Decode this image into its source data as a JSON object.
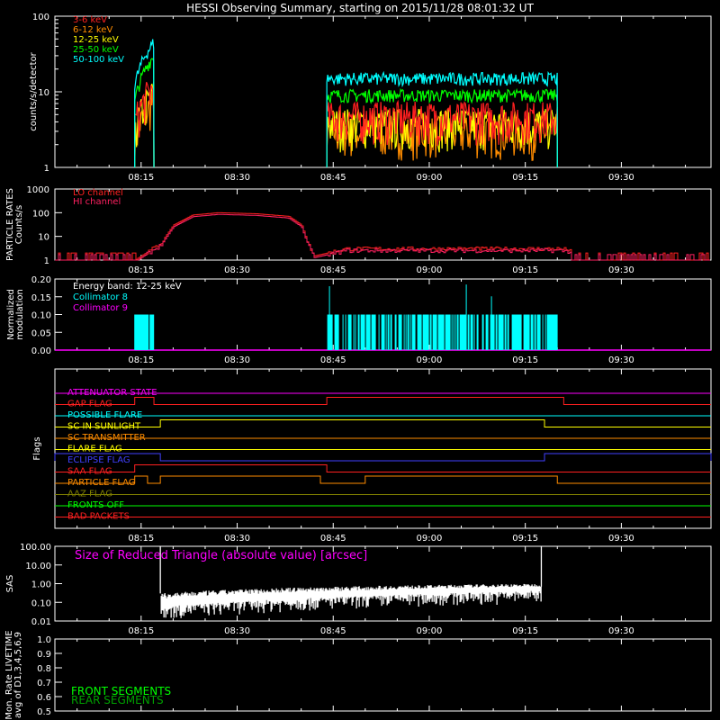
{
  "title": "HESSI Observing Summary, starting on 2015/11/28 08:01:32 UT",
  "time_ticks": [
    "08:15",
    "08:30",
    "08:45",
    "09:00",
    "09:15",
    "09:30"
  ],
  "chart_data": [
    {
      "type": "line",
      "panel": "count_rates",
      "ylabel": "counts/s/detector",
      "yscale": "log",
      "ylim": [
        1,
        100
      ],
      "yticks": [
        "1",
        "10",
        "100"
      ],
      "xlim": [
        "08:01:32",
        "09:44"
      ],
      "series": [
        {
          "name": "3-6 keV",
          "color": "#ff2020",
          "level": 5.5
        },
        {
          "name": "6-12 keV",
          "color": "#ff8c00",
          "level": 3.5
        },
        {
          "name": "12-25 keV",
          "color": "#ffff00",
          "level": 4.5
        },
        {
          "name": "25-50 keV",
          "color": "#00ff00",
          "level": 9
        },
        {
          "name": "50-100 keV",
          "color": "#00ffff",
          "level": 15
        }
      ],
      "observing_intervals": [
        [
          "08:14",
          "08:17"
        ],
        [
          "08:44",
          "09:20"
        ]
      ],
      "peak_values": {
        "50-100 keV": 45,
        "25-50 keV": 30
      }
    },
    {
      "type": "line",
      "panel": "particle_rates",
      "ylabel": "PARTICLE RATES Counts/s",
      "yscale": "log",
      "ylim": [
        1,
        1000
      ],
      "yticks": [
        "1",
        "10",
        "100",
        "1000"
      ],
      "series": [
        {
          "name": "LO channel",
          "color": "#ff2020"
        },
        {
          "name": "HI channel",
          "color": "#ff2060"
        }
      ],
      "profile": [
        {
          "t": "08:14",
          "v": 1
        },
        {
          "t": "08:18",
          "v": 5
        },
        {
          "t": "08:20",
          "v": 30
        },
        {
          "t": "08:23",
          "v": 80
        },
        {
          "t": "08:27",
          "v": 100
        },
        {
          "t": "08:33",
          "v": 90
        },
        {
          "t": "08:38",
          "v": 70
        },
        {
          "t": "08:40",
          "v": 30
        },
        {
          "t": "08:41",
          "v": 5
        },
        {
          "t": "08:42",
          "v": 1.5
        },
        {
          "t": "08:47",
          "v": 3
        },
        {
          "t": "09:20",
          "v": 3
        },
        {
          "t": "09:44",
          "v": 1
        }
      ]
    },
    {
      "type": "bar",
      "panel": "modulation",
      "ylabel": "Normalized modulation",
      "ylim": [
        0,
        0.2
      ],
      "yticks": [
        "0.00",
        "0.05",
        "0.10",
        "0.15",
        "0.20"
      ],
      "annotation": "Energy band: 12-25 keV",
      "series": [
        {
          "name": "Collimator 8",
          "color": "#00ffff",
          "typical": 0.1,
          "intervals": [
            [
              "08:14",
              "08:17"
            ],
            [
              "08:44",
              "09:20"
            ]
          ]
        },
        {
          "name": "Collimator 9",
          "color": "#ff00ff",
          "typical": 0.0
        }
      ]
    },
    {
      "type": "line",
      "panel": "flags",
      "ylabel": "Flags",
      "series": [
        {
          "name": "ATTENUATOR STATE",
          "color": "#ff00ff",
          "segments": []
        },
        {
          "name": "GAP FLAG",
          "color": "#ff2020",
          "segments": [
            [
              "08:14",
              "08:17"
            ],
            [
              "08:44",
              "09:21"
            ]
          ]
        },
        {
          "name": "POSSIBLE FLARE",
          "color": "#00ffff",
          "segments": []
        },
        {
          "name": "SC IN SUNLIGHT",
          "color": "#ffff00",
          "segments": [
            [
              "08:18",
              "09:18"
            ]
          ]
        },
        {
          "name": "SC TRANSMITTER",
          "color": "#ff8c00",
          "segments": []
        },
        {
          "name": "FLARE FLAG",
          "color": "#ffff00",
          "segments": []
        },
        {
          "name": "ECLIPSE FLAG",
          "color": "#4040ff",
          "segments": [
            [
              "08:01:32",
              "08:18"
            ],
            [
              "09:18",
              "09:44"
            ]
          ]
        },
        {
          "name": "SAA FLAG",
          "color": "#ff2020",
          "segments": [
            [
              "08:14",
              "08:44"
            ]
          ]
        },
        {
          "name": "PARTICLE FLAG",
          "color": "#ff8c00",
          "segments": [
            [
              "08:14",
              "08:16"
            ],
            [
              "08:18",
              "08:43"
            ],
            [
              "08:50",
              "09:20"
            ]
          ]
        },
        {
          "name": "AAZ FLAG",
          "color": "#808000",
          "segments": []
        },
        {
          "name": "FRONTS OFF",
          "color": "#00ff00",
          "segments": []
        },
        {
          "name": "BAD PACKETS",
          "color": "#ff2020",
          "segments": []
        }
      ]
    },
    {
      "type": "line",
      "panel": "sas",
      "ylabel": "SAS",
      "yscale": "log",
      "ylim": [
        0.01,
        100
      ],
      "yticks": [
        "100.00",
        "10.00",
        "1.00",
        "0.10",
        "0.01"
      ],
      "series": [
        {
          "name": "Size of Reduced Triangle (absolute value) [arcsec]",
          "color": "#ffffff",
          "profile": [
            {
              "t": "08:18",
              "v": 100
            },
            {
              "t": "08:19",
              "v": 0.3
            },
            {
              "t": "08:30",
              "v": 0.2
            },
            {
              "t": "08:45",
              "v": 0.4
            },
            {
              "t": "09:00",
              "v": 0.6
            },
            {
              "t": "09:17",
              "v": 0.7
            },
            {
              "t": "09:17:30",
              "v": 100
            }
          ]
        }
      ]
    },
    {
      "type": "line",
      "panel": "livetime",
      "ylabel": "Mon. Rate LIVETIME avg of D1,3,4,5,6,9",
      "ylim": [
        0.5,
        1.0
      ],
      "yticks": [
        "0.5",
        "0.6",
        "0.7",
        "0.8",
        "0.9",
        "1.0"
      ],
      "series": [
        {
          "name": "FRONT SEGMENTS",
          "color": "#00ff00"
        },
        {
          "name": "REAR SEGMENTS",
          "color": "#00a000"
        }
      ]
    }
  ]
}
